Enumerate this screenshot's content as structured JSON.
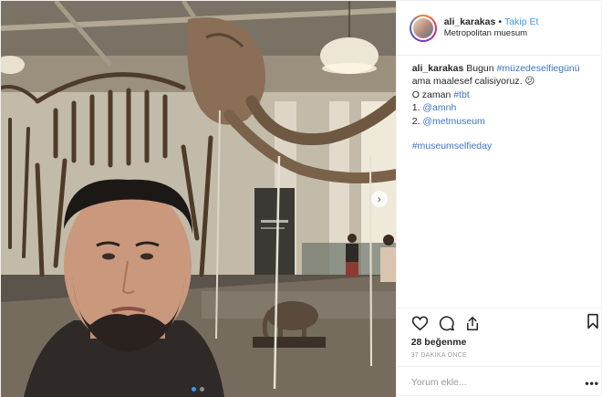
{
  "header": {
    "username": "ali_karakas",
    "separator": "•",
    "follow_label": "Takip Et",
    "location": "Metropolitan muesum"
  },
  "caption": {
    "username": "ali_karakas",
    "line1_text": "Bugun",
    "line1_tag": "#müzedeselfiegünü",
    "line1_rest": "ama maalesef calisiyoruz. 😕",
    "line2_text": "O zaman",
    "line2_tag": "#tbt",
    "item1_num": "1.",
    "item1_mention": "@amnh",
    "item2_num": "2.",
    "item2_mention": "@metmuseum",
    "hashtag": "#museumselfieday"
  },
  "stats": {
    "likes": "28 beğenme",
    "time": "37 DAKİKA ÖNCE"
  },
  "comment": {
    "placeholder": "Yorum ekle...",
    "more": "•••"
  },
  "carousel": {
    "next_arrow": "›",
    "dots": 2,
    "active_dot": 0
  },
  "icons": {
    "like": "heart-icon",
    "comment": "comment-bubble-icon",
    "share": "share-icon",
    "save": "bookmark-icon",
    "next": "chevron-right-icon"
  },
  "colors": {
    "link": "#3897f0",
    "text": "#262626",
    "muted": "#999999",
    "border": "#efefef"
  }
}
